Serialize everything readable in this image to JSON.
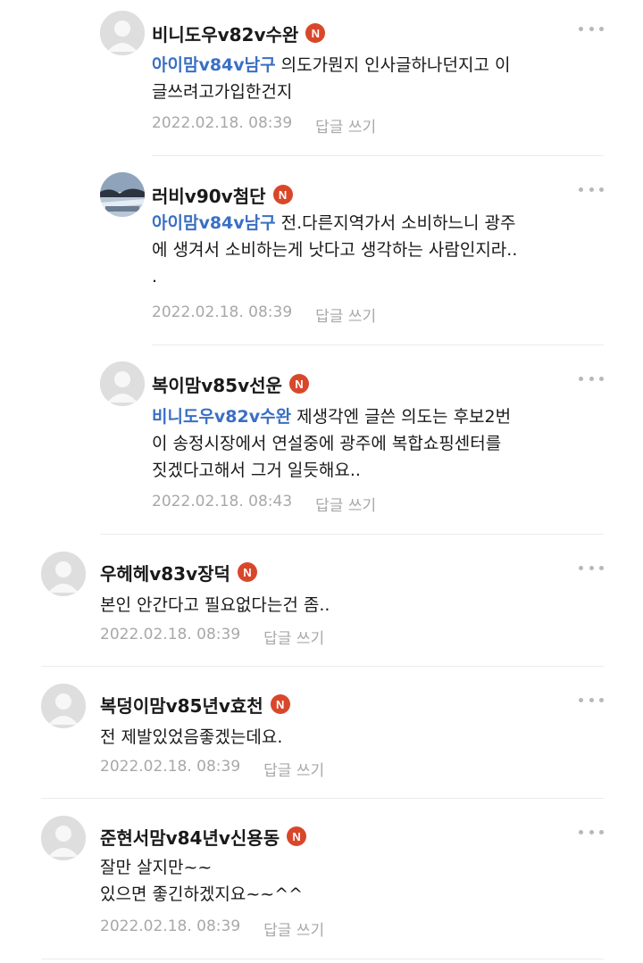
{
  "comments": [
    {
      "nickname": "비니도우v82v수완",
      "badge": "N",
      "mention": "아이맘v84v남구",
      "text_line1": " 의도가뭔지  인사글하나던지고 이",
      "text_line2": "글쓰려고가입한건지",
      "text_line3": "",
      "date": "2022.02.18. 08:39",
      "reply_label": "답글 쓰기",
      "avatar": "default"
    },
    {
      "nickname": "러비v90v첨단",
      "badge": "N",
      "mention": "아이맘v84v남구",
      "text_line1": " 전.다른지역가서 소비하느니 광주",
      "text_line2": "에 생겨서 소비하는게 낫다고 생각하는 사람인지라..",
      "text_line3": ".",
      "date": "2022.02.18. 08:39",
      "reply_label": "답글 쓰기",
      "avatar": "photo"
    },
    {
      "nickname": "복이맘v85v선운",
      "badge": "N",
      "mention": "비니도우v82v수완",
      "text_line1": " 제생각엔 글쓴 의도는 후보2번",
      "text_line2": "이 송정시장에서 연설중에 광주에 복합쇼핑센터를",
      "text_line3": "짓겠다고해서 그거 일듯해요..",
      "date": "2022.02.18. 08:43",
      "reply_label": "답글 쓰기",
      "avatar": "default"
    },
    {
      "nickname": "우헤헤v83v장덕",
      "badge": "N",
      "text_line1": "본인 안간다고 필요없다는건 좀..",
      "text_line2": "",
      "date": "2022.02.18. 08:39",
      "reply_label": "답글 쓰기",
      "avatar": "default"
    },
    {
      "nickname": "복덩이맘v85년v효천",
      "badge": "N",
      "text_line1": "전 제발있었음좋겠는데요.",
      "text_line2": "",
      "date": "2022.02.18. 08:39",
      "reply_label": "답글 쓰기",
      "avatar": "default"
    },
    {
      "nickname": "준현서맘v84년v신용동",
      "badge": "N",
      "text_line1": "잘만 살지만~~",
      "text_line2": "있으면 좋긴하겠지요~~^^",
      "date": "2022.02.18. 08:39",
      "reply_label": "답글 쓰기",
      "avatar": "default"
    }
  ],
  "colors": {
    "mention": "#3a6fc4",
    "badge": "#d9472b",
    "meta": "#a8a8a8",
    "divider": "#ebebeb"
  },
  "icons": {
    "more": "more-horizontal-icon",
    "badge": "n-badge-icon",
    "avatar": "default-avatar-icon"
  }
}
